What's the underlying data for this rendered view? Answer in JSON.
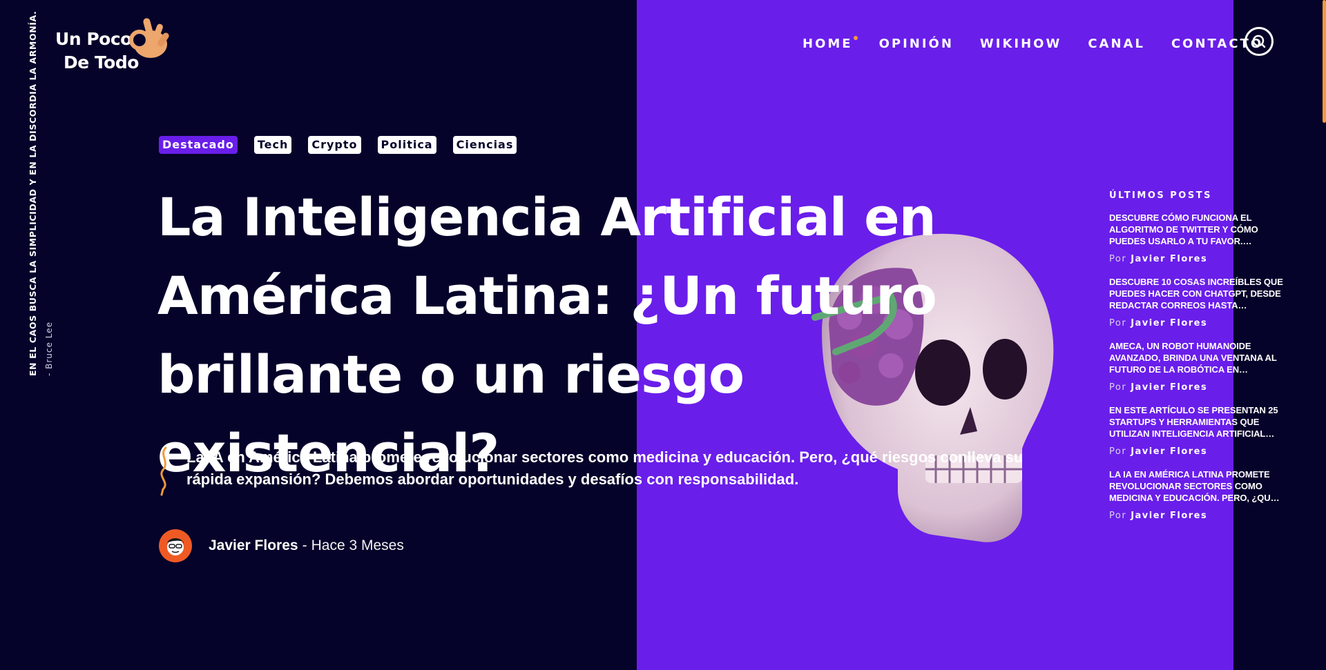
{
  "site": {
    "logo_line1": "Un Poco",
    "logo_line2": "De Todo",
    "vertical_quote": "EN EL CAOS BUSCA LA SIMPLICIDAD Y EN LA DISCORDIA LA ARMONÍA.",
    "vertical_quote_author": "- Bruce Lee"
  },
  "nav": {
    "items": [
      {
        "label": "HOME"
      },
      {
        "label": "OPINIÓN"
      },
      {
        "label": "WIKIHOW"
      },
      {
        "label": "CANAL"
      },
      {
        "label": "CONTACTO"
      }
    ],
    "search_icon": "search-icon"
  },
  "hero": {
    "tags": [
      "Destacado",
      "Tech",
      "Crypto",
      "Politica",
      "Ciencias"
    ],
    "active_tag": "Destacado",
    "title": "La Inteligencia Artificial en América Latina: ¿Un futuro brillante o un riesgo existencial?",
    "excerpt": "La IA en América Latina promete revolucionar sectores como medicina y educación. Pero, ¿qué riesgos conlleva su rápida expansión? Debemos abordar oportunidades y desafíos con responsabilidad.",
    "author": "Javier Flores",
    "separator": "-",
    "time": "Hace 3 Meses"
  },
  "latest_posts": {
    "heading": "ÚLTIMOS POSTS",
    "by_label": "Por",
    "posts": [
      {
        "title": "DESCUBRE CÓMO FUNCIONA EL ALGORITMO DE TWITTER Y CÓMO PUEDES USARLO A TU FAVOR.…",
        "author": "Javier Flores"
      },
      {
        "title": "DESCUBRE 10 COSAS INCREÍBLES QUE PUEDES HACER CON CHATGPT, DESDE REDACTAR CORREOS HASTA…",
        "author": "Javier Flores"
      },
      {
        "title": "AMECA, UN ROBOT HUMANOIDE AVANZADO, BRINDA UNA VENTANA AL FUTURO DE LA ROBÓTICA EN…",
        "author": "Javier Flores"
      },
      {
        "title": "EN ESTE ARTÍCULO SE PRESENTAN 25 STARTUPS Y HERRAMIENTAS QUE UTILIZAN INTELIGENCIA ARTIFICIAL…",
        "author": "Javier Flores"
      },
      {
        "title": "LA IA EN AMÉRICA LATINA PROMETE REVOLUCIONAR SECTORES COMO MEDICINA Y EDUCACIÓN. PERO, ¿QU…",
        "author": "Javier Flores"
      }
    ]
  },
  "colors": {
    "background": "#05032a",
    "accent_purple": "#6a1eea",
    "accent_orange": "#f39a3b",
    "avatar_bg": "#ef5a24"
  }
}
